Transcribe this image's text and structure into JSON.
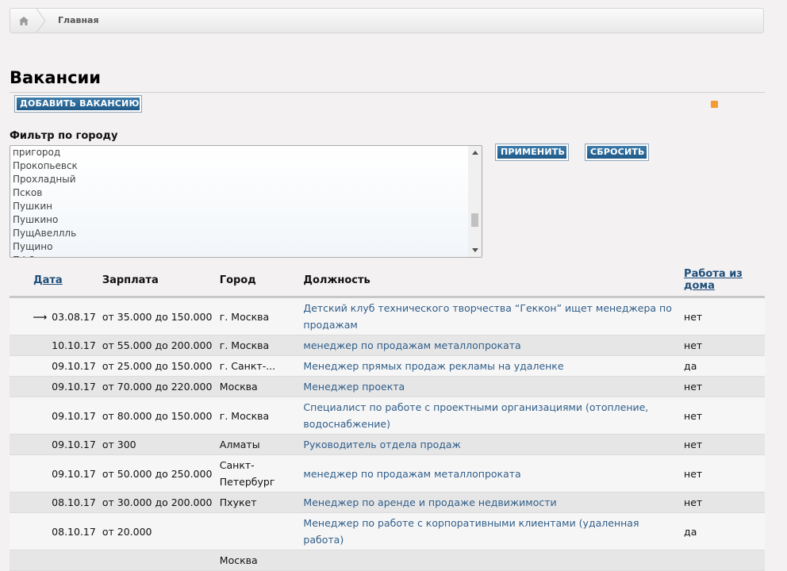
{
  "breadcrumb": {
    "current": "Главная"
  },
  "page": {
    "title": "Вакансии",
    "add_button": "ДОБАВИТЬ ВАКАНСИЮ"
  },
  "filter": {
    "label": "Фильтр по городу",
    "cities": [
      "пригород",
      "Прокопьевск",
      "Прохладный",
      "Псков",
      "Пушкин",
      "Пушкино",
      "ПущАвеллль",
      "Пущино",
      "ПФО"
    ],
    "apply_button": "ПРИМЕНИТЬ",
    "reset_button": "СБРОСИТЬ"
  },
  "table": {
    "headers": {
      "date": "Дата",
      "salary": "Зарплата",
      "city": "Город",
      "position": "Должность",
      "remote": "Работа из дома"
    },
    "rows": [
      {
        "date": "03.08.17",
        "salary": "от 35.000 до 150.000",
        "city": "г. Москва",
        "position": "Детский клуб технического творчества “Геккон” ищет менеджера по продажам",
        "remote": "нет"
      },
      {
        "date": "10.10.17",
        "salary": "от 55.000 до 200.000",
        "city": "г. Москва",
        "position": "менеджер по продажам металлопроката",
        "remote": "нет"
      },
      {
        "date": "09.10.17",
        "salary": "от 25.000 до 150.000",
        "city": "г. Санкт-...",
        "position": "Менеджер прямых продаж рекламы на удаленке",
        "remote": "да"
      },
      {
        "date": "09.10.17",
        "salary": "от 70.000 до 220.000",
        "city": "Москва",
        "position": "Менеджер проекта",
        "remote": "нет"
      },
      {
        "date": "09.10.17",
        "salary": "от 80.000 до 150.000",
        "city": "г. Москва",
        "position": "Специалист по работе с проектными организациями (отопление, водоснабжение)",
        "remote": "нет"
      },
      {
        "date": "09.10.17",
        "salary": "от 300",
        "city": "Алматы",
        "position": "Руководитель отдела продаж",
        "remote": "нет"
      },
      {
        "date": "09.10.17",
        "salary": "от 50.000 до 250.000",
        "city": "Санкт-Петербург",
        "position": "менеджер по продажам металлопроката",
        "remote": "нет"
      },
      {
        "date": "08.10.17",
        "salary": "от 30.000 до 200.000",
        "city": "Пхукет",
        "position": "Менеджер по аренде и продаже недвижимости",
        "remote": "нет"
      },
      {
        "date": "08.10.17",
        "salary": "от 20.000",
        "city": "",
        "position": "Менеджер по работе с корпоративными клиентами (удаленная работа)",
        "remote": "да"
      },
      {
        "date": "",
        "salary": "",
        "city": "Москва",
        "position": "",
        "remote": ""
      }
    ]
  }
}
